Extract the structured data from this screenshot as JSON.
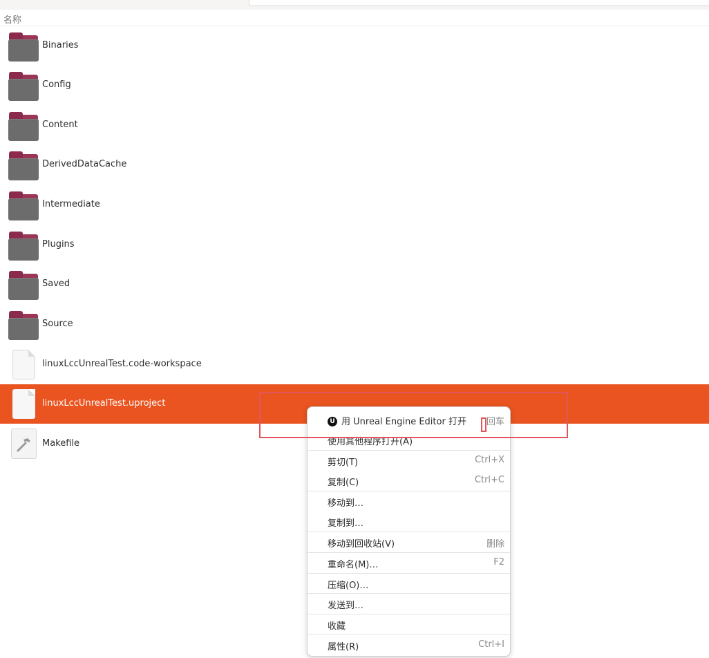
{
  "header": {
    "column_name": "名称"
  },
  "files": [
    {
      "name": "Binaries",
      "type": "folder",
      "selected": false
    },
    {
      "name": "Config",
      "type": "folder",
      "selected": false
    },
    {
      "name": "Content",
      "type": "folder",
      "selected": false
    },
    {
      "name": "DerivedDataCache",
      "type": "folder",
      "selected": false
    },
    {
      "name": "Intermediate",
      "type": "folder",
      "selected": false
    },
    {
      "name": "Plugins",
      "type": "folder",
      "selected": false
    },
    {
      "name": "Saved",
      "type": "folder",
      "selected": false
    },
    {
      "name": "Source",
      "type": "folder",
      "selected": false
    },
    {
      "name": "linuxLccUnrealTest.code-workspace",
      "type": "document",
      "selected": false
    },
    {
      "name": "linuxLccUnrealTest.uproject",
      "type": "document",
      "selected": true
    },
    {
      "name": "Makefile",
      "type": "makefile",
      "selected": false
    }
  ],
  "context_menu": {
    "items": [
      {
        "label": "用 Unreal Engine Editor 打开",
        "shortcut": "回车",
        "icon": "unreal-engine-icon"
      },
      {
        "label": "使用其他程序打开(A)",
        "shortcut": ""
      },
      {
        "label": "剪切(T)",
        "shortcut": "Ctrl+X"
      },
      {
        "label": "复制(C)",
        "shortcut": "Ctrl+C"
      },
      {
        "label": "移动到…",
        "shortcut": ""
      },
      {
        "label": "复制到…",
        "shortcut": ""
      },
      {
        "label": "移动到回收站(V)",
        "shortcut": "删除"
      },
      {
        "label": "重命名(M)…",
        "shortcut": "F2"
      },
      {
        "label": "压缩(O)…",
        "shortcut": ""
      },
      {
        "label": "发送到…",
        "shortcut": ""
      },
      {
        "label": "收藏",
        "shortcut": ""
      },
      {
        "label": "属性(R)",
        "shortcut": "Ctrl+I"
      }
    ]
  },
  "colors": {
    "selection": "#e95420",
    "folder_tab": "#9c3657",
    "folder_body": "#6c6c6c",
    "annotation": "#e2565b"
  }
}
